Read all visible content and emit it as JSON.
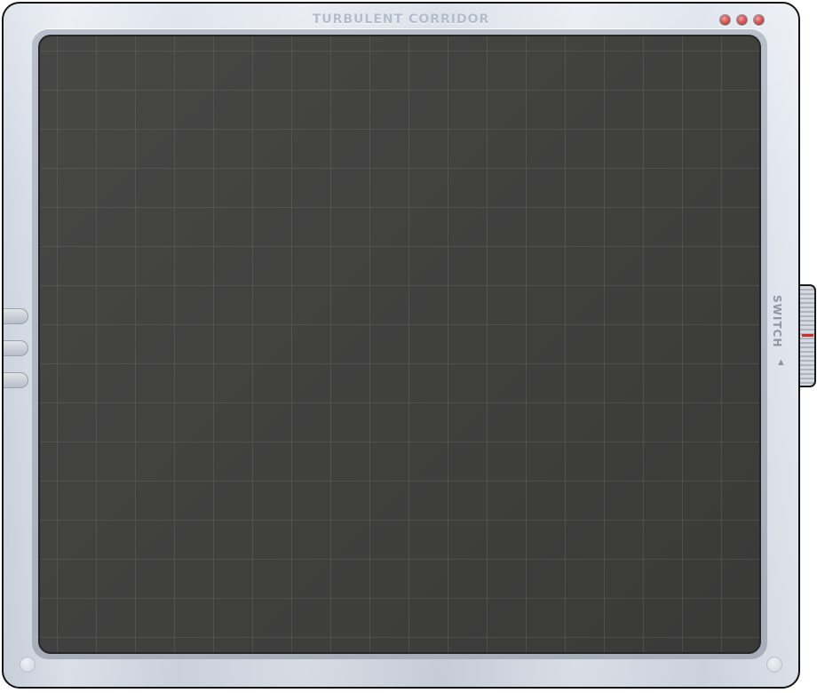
{
  "window": {
    "title": "TURBULENT CORRIDOR"
  },
  "controls": {
    "switch_label": "SWITCH",
    "switch_arrow": "▲"
  },
  "colors": {
    "screen_background": "#3d3d3c",
    "grid_line": "#6e6e69",
    "window_button": "#d35c5c",
    "switch_marker": "#d02c2c"
  },
  "icons": {
    "window_buttons": [
      "window-button-icon",
      "window-button-icon",
      "window-button-icon"
    ],
    "switch": "switch-knob-icon"
  }
}
